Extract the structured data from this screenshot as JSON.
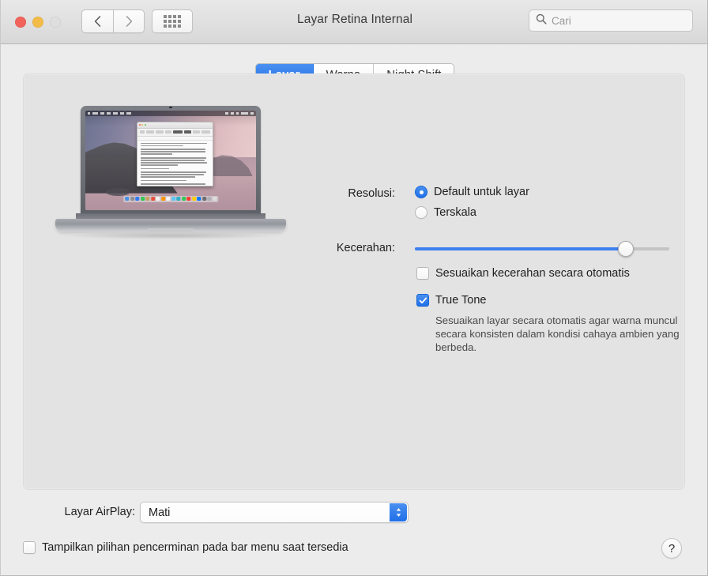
{
  "window": {
    "title": "Layar Retina Internal",
    "traffic_lights": [
      "close",
      "minimize",
      "zoom"
    ]
  },
  "toolbar": {
    "back_label": "Kembali",
    "forward_label": "Maju",
    "show_all_label": "Tampilkan Semua",
    "search": {
      "placeholder": "Cari",
      "value": ""
    }
  },
  "tabs": [
    {
      "label": "Layar",
      "active": true
    },
    {
      "label": "Warna",
      "active": false
    },
    {
      "label": "Night Shift",
      "active": false
    }
  ],
  "preview": {
    "device_label": "MacBook Pro"
  },
  "display": {
    "resolution": {
      "label": "Resolusi:",
      "options": [
        {
          "label": "Default untuk layar",
          "selected": true
        },
        {
          "label": "Terskala",
          "selected": false
        }
      ]
    },
    "brightness": {
      "label": "Kecerahan:",
      "value": 83,
      "min": 0,
      "max": 100
    },
    "auto_brightness": {
      "label": "Sesuaikan kecerahan secara otomatis",
      "checked": false
    },
    "true_tone": {
      "label": "True Tone",
      "checked": true,
      "description": "Sesuaikan layar secara otomatis agar warna muncul secara konsisten dalam kondisi cahaya ambien yang berbeda."
    }
  },
  "footer": {
    "airplay": {
      "label": "Layar AirPlay:",
      "value": "Mati"
    },
    "mirroring": {
      "label": "Tampilkan pilihan pencerminan pada bar menu saat tersedia",
      "checked": false
    },
    "help_label": "?"
  },
  "colors": {
    "accent": "#1f6fe8",
    "window_bg": "#ececec",
    "content_bg": "#e3e3e3",
    "text": "#1e1e1e"
  }
}
